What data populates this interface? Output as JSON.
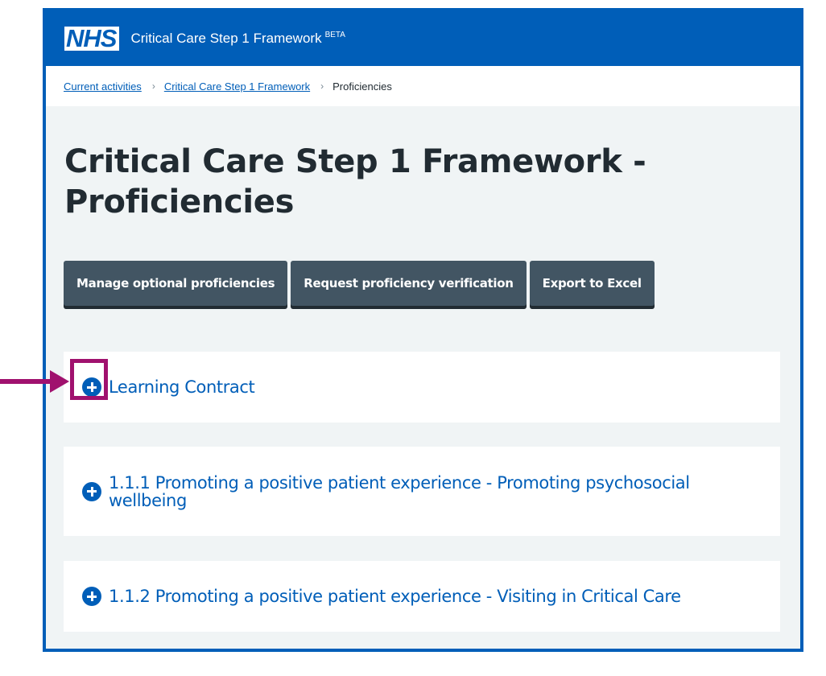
{
  "header": {
    "logo_text": "NHS",
    "service_name": "Critical Care Step 1 Framework",
    "beta_tag": "BETA"
  },
  "breadcrumb": {
    "items": [
      {
        "label": "Current activities"
      },
      {
        "label": "Critical Care Step 1 Framework"
      }
    ],
    "separator": "›",
    "current": "Proficiencies"
  },
  "page": {
    "title": "Critical Care Step 1 Framework - Proficiencies"
  },
  "buttons": {
    "manage": "Manage optional proficiencies",
    "request": "Request proficiency verification",
    "export": "Export to Excel"
  },
  "sections": [
    {
      "title": "Learning Contract",
      "icon": "plus-circle-icon"
    },
    {
      "title": "1.1.1 Promoting a positive patient experience - Promoting psychosocial wellbeing",
      "icon": "plus-circle-icon"
    },
    {
      "title": "1.1.2 Promoting a positive patient experience - Visiting in Critical Care",
      "icon": "plus-circle-icon"
    }
  ],
  "annotation": {
    "color": "#a0116e",
    "icon": "arrow-right-icon"
  },
  "colors": {
    "brand": "#005eb8",
    "button": "#425563",
    "page_bg": "#f0f4f5"
  }
}
